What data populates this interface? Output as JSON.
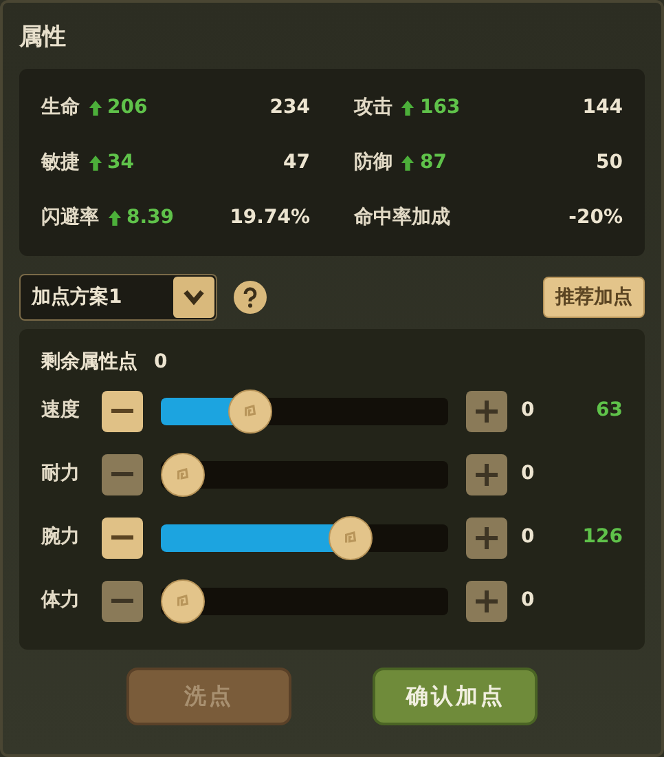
{
  "title": "属性",
  "stats": [
    {
      "label": "生命",
      "bonus": "206",
      "value": "234"
    },
    {
      "label": "攻击",
      "bonus": "163",
      "value": "144"
    },
    {
      "label": "敏捷",
      "bonus": "34",
      "value": "47"
    },
    {
      "label": "防御",
      "bonus": "87",
      "value": "50"
    },
    {
      "label": "闪避率",
      "bonus": "8.39",
      "value": "19.74%"
    },
    {
      "label": "命中率加成",
      "value": "-20%"
    }
  ],
  "plan_select": {
    "value": "加点方案1"
  },
  "recommend_button": "推荐加点",
  "remaining": {
    "label": "剩余属性点",
    "value": "0"
  },
  "attributes": [
    {
      "name": "速度",
      "minus_disabled": false,
      "level": 0.31,
      "added": "0",
      "total": "63"
    },
    {
      "name": "耐力",
      "minus_disabled": true,
      "level": 0,
      "added": "0"
    },
    {
      "name": "腕力",
      "minus_disabled": false,
      "level": 0.66,
      "added": "0",
      "total": "126"
    },
    {
      "name": "体力",
      "minus_disabled": true,
      "level": 0,
      "added": "0"
    }
  ],
  "buttons": [
    {
      "label": "洗点",
      "kind": "reset",
      "disabled": true
    },
    {
      "label": "确认加点",
      "kind": "confirm",
      "disabled": false
    }
  ]
}
